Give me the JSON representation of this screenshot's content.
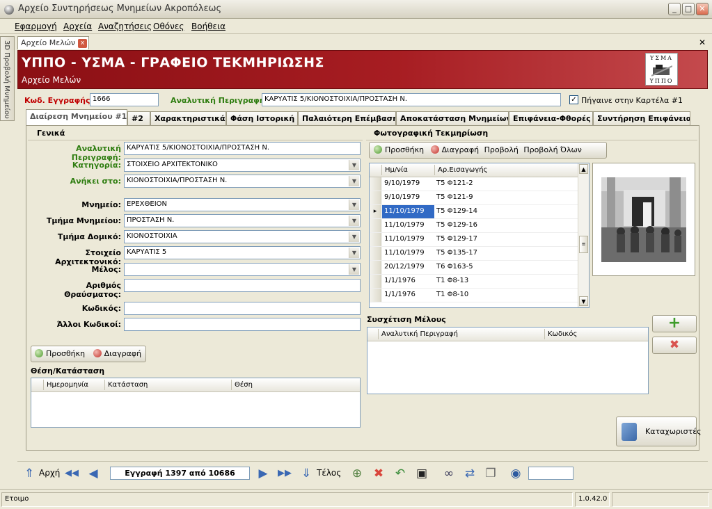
{
  "window": {
    "title": "Αρχείο Συντηρήσεως Μνημείων Ακροπόλεως",
    "minimize": "_",
    "maximize": "□",
    "close": "✕"
  },
  "menu": [
    "Εφαρμογή",
    "Αρχεία",
    "Αναζητήσεις",
    "Οθόνες",
    "Βοήθεια"
  ],
  "side_tab": "3D Προβολή Μνημείου",
  "doc_tab": {
    "label": "Αρχείο Μελών",
    "close": "x",
    "window_close": "✕"
  },
  "banner": {
    "title": "ΥΠΠΟ - ΥΣΜΑ - ΓΡΑΦΕΙΟ ΤΕΚΜΗΡΙΩΣΗΣ",
    "subtitle": "Αρχείο Μελών",
    "logo_top": "ΥΣΜΑ",
    "logo_bottom": "ΥΠΠΟ"
  },
  "header_fields": {
    "code_label": "Κωδ. Εγγραφής :",
    "code_value": "1666",
    "desc_label": "Αναλυτική Περιγραφή :",
    "desc_value": "ΚΑΡΥΑΤΙΣ 5/ΚΙΟΝΟΣΤΟΙΧΙΑ/ΠΡΟΣΤΑΣΗ Ν.",
    "goto_label": "Πήγαινε στην Καρτέλα #1",
    "goto_checked": true
  },
  "tabs": [
    "Διαίρεση Μνημείου #1",
    "#2",
    "Χαρακτηριστικά",
    "Φάση Ιστορική",
    "Παλαιότερη Επέμβαση",
    "Αποκατάσταση Μνημείων",
    "Επιφάνεια-Φθορές",
    "Συντήρηση Επιφάνειας"
  ],
  "general": {
    "title": "Γενικά",
    "fields": [
      {
        "label": "Αναλυτική Περιγραφή:",
        "value": "ΚΑΡΥΑΤΙΣ 5/ΚΙΟΝΟΣΤΟΙΧΙΑ/ΠΡΟΣΤΑΣΗ Ν."
      },
      {
        "label": "Κατηγορία:",
        "value": "ΣΤΟΙΧΕΙΟ ΑΡΧΙΤΕΚΤΟΝΙΚΟ"
      },
      {
        "label": "Ανήκει στο:",
        "value": "ΚΙΟΝΟΣΤΟΙΧΙΑ/ΠΡΟΣΤΑΣΗ Ν."
      },
      {
        "label": "Μνημείο:",
        "value": "ΕΡΕΧΘΕΙΟΝ"
      },
      {
        "label": "Τμήμα Μνημείου:",
        "value": "ΠΡΟΣΤΑΣΗ Ν."
      },
      {
        "label": "Τμήμα Δομικό:",
        "value": "ΚΙΟΝΟΣΤΟΙΧΙΑ"
      },
      {
        "label": "Στοιχείο Αρχιτεκτονικό:",
        "value": "ΚΑΡΥΑΤΙΣ 5"
      },
      {
        "label": "Μέλος:",
        "value": ""
      },
      {
        "label": "Αριθμός Θραύσματος:",
        "value": ""
      },
      {
        "label": "Κωδικός:",
        "value": ""
      },
      {
        "label": "Άλλοι Κωδικοί:",
        "value": ""
      }
    ],
    "add_label": "Προσθήκη",
    "delete_label": "Διαγραφή",
    "position_title": "Θέση/Κατάσταση",
    "position_columns": [
      "Ημερομηνία",
      "Κατάσταση",
      "Θέση"
    ]
  },
  "photo": {
    "title": "Φωτογραφική Τεκμηρίωση",
    "buttons": [
      "Προσθήκη",
      "Διαγραφή",
      "Προβολή",
      "Προβολή Όλων"
    ],
    "columns": [
      "Ημ/νία",
      "Αρ.Εισαγωγής"
    ],
    "rows": [
      {
        "date": "9/10/1979",
        "num": "Τ5 Φ121-2"
      },
      {
        "date": "9/10/1979",
        "num": "Τ5 Φ121-9"
      },
      {
        "date": "11/10/1979",
        "num": "Τ5 Φ129-14",
        "selected": true
      },
      {
        "date": "11/10/1979",
        "num": "Τ5 Φ129-16"
      },
      {
        "date": "11/10/1979",
        "num": "Τ5 Φ129-17"
      },
      {
        "date": "11/10/1979",
        "num": "Τ5 Φ135-17"
      },
      {
        "date": "20/12/1979",
        "num": "Τ6 Φ163-5"
      },
      {
        "date": "1/1/1976",
        "num": "Τ1 Φ8-13"
      },
      {
        "date": "1/1/1976",
        "num": "Τ1 Φ8-10"
      }
    ]
  },
  "relation": {
    "title": "Συσχέτιση Μέλους",
    "columns": [
      "Αναλυτική Περιγραφή",
      "Κωδικός"
    ],
    "add": "+",
    "remove": "✖"
  },
  "registrants_label": "Καταχωριστές",
  "nav": {
    "first": "Αρχή",
    "record": "Εγγραφή 1397 από 10686",
    "last": "Τέλος"
  },
  "status": {
    "text": "Ετοιμο",
    "version": "1.0.42.0"
  }
}
